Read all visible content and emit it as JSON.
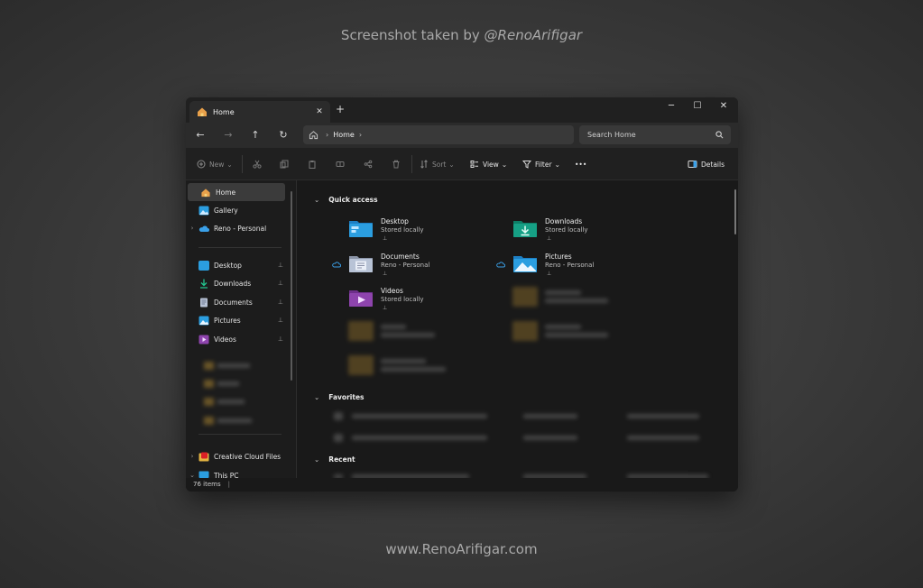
{
  "page": {
    "caption_prefix": "Screenshot taken by ",
    "caption_handle": "@RenoArifigar",
    "footer": "www.RenoArifigar.com"
  },
  "window": {
    "tab_title": "Home",
    "tab_close": "✕",
    "new_tab": "+",
    "controls": {
      "minimize": "─",
      "maximize": "☐",
      "close": "✕"
    }
  },
  "nav": {
    "back": "←",
    "forward": "→",
    "up": "↑",
    "refresh": "↻",
    "breadcrumb": "Home",
    "chevron": "›",
    "search_placeholder": "Search Home"
  },
  "toolbar": {
    "new_label": "New",
    "sort_label": "Sort",
    "view_label": "View",
    "filter_label": "Filter",
    "more_label": "•••",
    "details_label": "Details"
  },
  "sidebar": {
    "home": "Home",
    "gallery": "Gallery",
    "onedrive": "Reno - Personal",
    "pinned": [
      {
        "label": "Desktop",
        "icon": "desktop-folder-icon"
      },
      {
        "label": "Downloads",
        "icon": "downloads-folder-icon"
      },
      {
        "label": "Documents",
        "icon": "documents-folder-icon"
      },
      {
        "label": "Pictures",
        "icon": "pictures-folder-icon"
      },
      {
        "label": "Videos",
        "icon": "videos-folder-icon"
      }
    ],
    "creative_cloud": "Creative Cloud Files",
    "this_pc": "This PC",
    "pin_glyph": "📌"
  },
  "main": {
    "quick_access_header": "Quick access",
    "favorites_header": "Favorites",
    "recent_header": "Recent",
    "quick_access": [
      {
        "name": "Desktop",
        "sub": "Stored locally"
      },
      {
        "name": "Downloads",
        "sub": "Stored locally"
      },
      {
        "name": "Documents",
        "sub": "Reno - Personal"
      },
      {
        "name": "Pictures",
        "sub": "Reno - Personal"
      },
      {
        "name": "Videos",
        "sub": "Stored locally"
      }
    ]
  },
  "status": {
    "items": "76 items"
  },
  "colors": {
    "accent_blue": "#3aa0e8",
    "folder_desktop": "#2b9ee0",
    "folder_downloads": "#16a085",
    "folder_videos": "#8e44ad"
  }
}
